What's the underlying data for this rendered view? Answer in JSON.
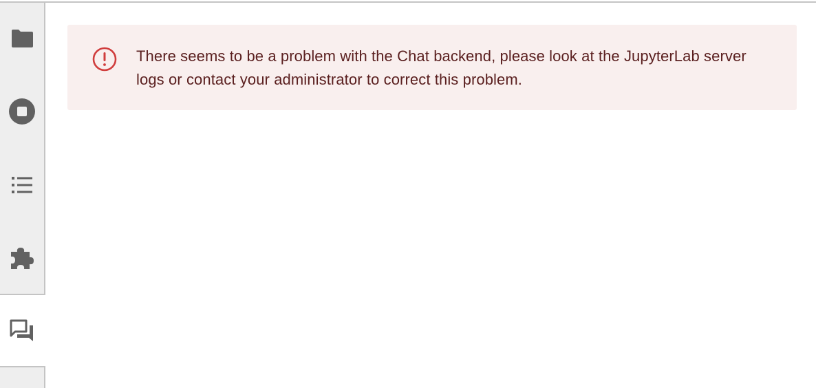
{
  "sidebar": {
    "tabs": [
      {
        "name": "file-browser",
        "icon": "folder-icon"
      },
      {
        "name": "running-sessions",
        "icon": "stop-circle-icon"
      },
      {
        "name": "table-of-contents",
        "icon": "list-icon"
      },
      {
        "name": "extension-manager",
        "icon": "puzzle-icon"
      },
      {
        "name": "chat",
        "icon": "chat-bubbles-icon",
        "active": true
      }
    ]
  },
  "alert": {
    "severity": "error",
    "icon": "error-circle-icon",
    "message": "There seems to be a problem with the Chat backend, please look at the JupyterLab server logs or contact your administrator to correct this problem."
  },
  "colors": {
    "alert_background": "#f9efee",
    "alert_icon": "#d03d3d",
    "alert_text": "#5b2020",
    "icon_gray": "#616161",
    "sidebar_background": "#eeeeee"
  }
}
